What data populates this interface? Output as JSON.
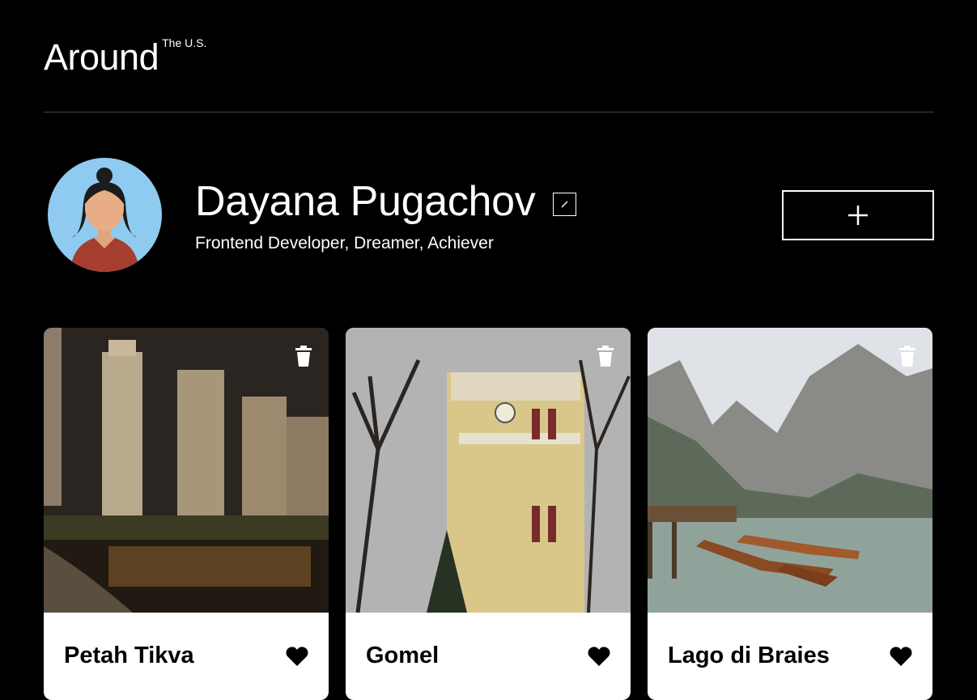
{
  "header": {
    "logo_main": "Around",
    "logo_sup": "The U.S."
  },
  "profile": {
    "name": "Dayana Pugachov",
    "about": "Frontend Developer, Dreamer, Achiever",
    "edit_icon": "pencil-icon",
    "add_icon": "plus-icon"
  },
  "cards": [
    {
      "title": "Petah Tikva",
      "image": "night city skyline reflected in water",
      "liked": true
    },
    {
      "title": "Gomel",
      "image": "yellow clock tower behind bare trees",
      "liked": true
    },
    {
      "title": "Lago di Braies",
      "image": "mountain lake with wooden boats",
      "liked": true
    }
  ],
  "colors": {
    "background": "#000000",
    "card": "#ffffff",
    "avatar_bg": "#8fcbf0",
    "avatar_shirt": "#a63e2f"
  }
}
